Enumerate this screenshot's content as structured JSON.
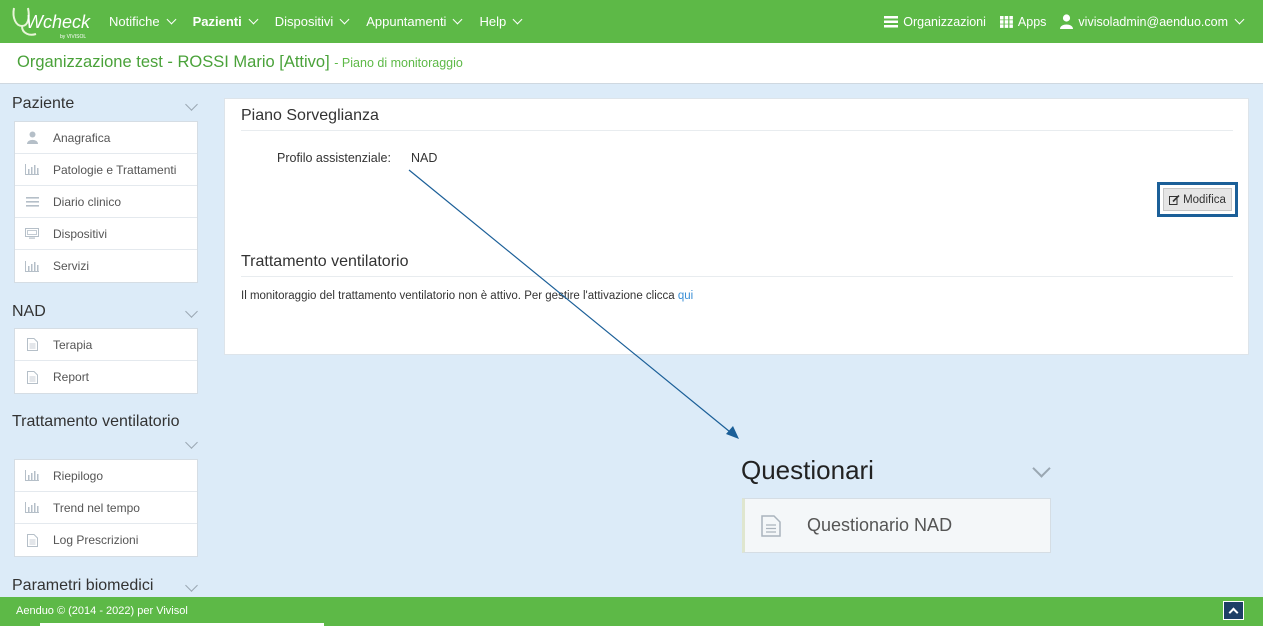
{
  "brand": {
    "logo_text": "Wcheck",
    "logo_sub": "by VIVISOL",
    "logo_icon": "stethoscope-icon"
  },
  "nav": {
    "items": [
      {
        "label": "Notifiche"
      },
      {
        "label": "Pazienti"
      },
      {
        "label": "Dispositivi"
      },
      {
        "label": "Appuntamenti"
      },
      {
        "label": "Help"
      }
    ],
    "right": {
      "organizzazioni": "Organizzazioni",
      "apps": "Apps",
      "user": "vivisoladmin@aenduo.com"
    }
  },
  "header": {
    "title": "Organizzazione test - ROSSI Mario [Attivo]",
    "subtitle": "- Piano di monitoraggio"
  },
  "sidebar": {
    "groups": [
      {
        "title": "Paziente",
        "items": [
          {
            "label": "Anagrafica",
            "icon": "user-icon"
          },
          {
            "label": "Patologie e Trattamenti",
            "icon": "bar-chart-icon"
          },
          {
            "label": "Diario clinico",
            "icon": "list-icon"
          },
          {
            "label": "Dispositivi",
            "icon": "device-icon"
          },
          {
            "label": "Servizi",
            "icon": "bar-chart-icon"
          }
        ]
      },
      {
        "title": "NAD",
        "items": [
          {
            "label": "Terapia",
            "icon": "document-icon"
          },
          {
            "label": "Report",
            "icon": "document-icon"
          }
        ]
      },
      {
        "title": "Trattamento ventilatorio",
        "items": [
          {
            "label": "Riepilogo",
            "icon": "bar-chart-icon"
          },
          {
            "label": "Trend nel tempo",
            "icon": "bar-chart-icon"
          },
          {
            "label": "Log Prescrizioni",
            "icon": "document-icon"
          }
        ]
      },
      {
        "title": "Parametri biomedici",
        "items": []
      }
    ]
  },
  "main": {
    "piano_title": "Piano Sorveglianza",
    "profile_label": "Profilo assistenziale:",
    "profile_value": "NAD",
    "edit_label": "Modifica",
    "vent_title": "Trattamento ventilatorio",
    "vent_text": "Il monitoraggio del trattamento ventilatorio non è attivo. Per gestire l'attivazione clicca",
    "vent_link": "qui"
  },
  "questionari": {
    "title": "Questionari",
    "item": "Questionario NAD"
  },
  "footer": {
    "text": "Aenduo © (2014 - 2022) per Vivisol"
  },
  "colors": {
    "brand_green": "#5db947",
    "highlight_blue": "#1b5f98",
    "link_blue": "#3a8fd6",
    "page_bg": "#dcebf8"
  }
}
